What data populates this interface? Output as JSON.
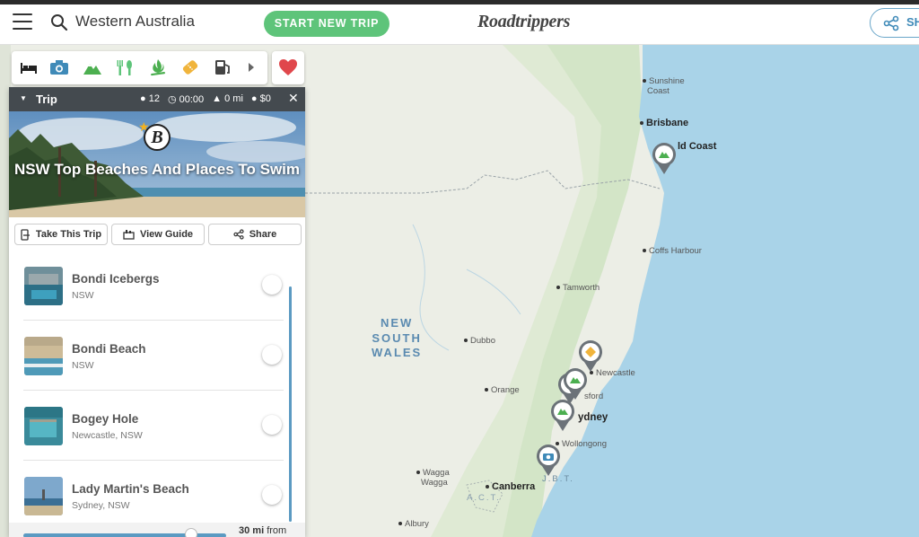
{
  "search": {
    "value": "Western Australia"
  },
  "topbar": {
    "start_button": "START NEW TRIP",
    "logo": "Roadtrippers",
    "share_label": "SH"
  },
  "categories": {
    "icons": [
      "bed-icon",
      "camera-icon",
      "mountain-icon",
      "dining-icon",
      "campfire-icon",
      "bandage-icon",
      "fuel-icon",
      "chevron-right-icon"
    ],
    "favorite": "heart-icon"
  },
  "trip": {
    "header_label": "Trip",
    "stops_count": "12",
    "duration": "00:00",
    "distance": "0 mi",
    "cost": "$0",
    "title": "NSW Top Beaches And Places To Swim",
    "actions": {
      "take": "Take This Trip",
      "guide": "View Guide",
      "share": "Share"
    },
    "stops": [
      {
        "name": "Bondi Icebergs",
        "location": "NSW"
      },
      {
        "name": "Bondi Beach",
        "location": "NSW"
      },
      {
        "name": "Bogey Hole",
        "location": "Newcastle, NSW"
      },
      {
        "name": "Lady Martin's Beach",
        "location": "Sydney, NSW"
      }
    ],
    "radius_value": "30 mi",
    "radius_suffix": "from"
  },
  "map": {
    "state_label": [
      "NEW",
      "SOUTH",
      "WALES"
    ],
    "cities": {
      "sunshine": "Sunshine",
      "sunshine2": "Coast",
      "brisbane": "Brisbane",
      "goldcoast": "ld Coast",
      "coffs": "Coffs Harbour",
      "tamworth": "Tamworth",
      "dubbo": "Dubbo",
      "newcastle": "Newcastle",
      "orange": "Orange",
      "gosford": "sford",
      "sydney": "ydney",
      "wollongong": "Wollongong",
      "wagga": "Wagga",
      "wagga2": "Wagga",
      "act": "A.C.T.",
      "canberra": "Canberra",
      "jbt": "J.B.T.",
      "albury": "Albury"
    }
  },
  "colors": {
    "accent_green": "#5ec47a",
    "accent_blue": "#3f8ab8",
    "ocean": "#a9d3e8",
    "land": "#eceee6",
    "header": "#444a4f"
  }
}
